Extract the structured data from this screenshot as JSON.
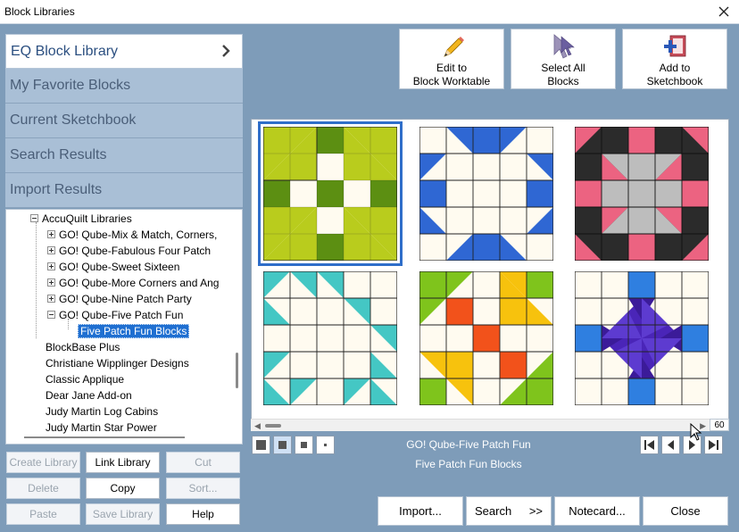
{
  "window": {
    "title": "Block Libraries"
  },
  "nav": {
    "items": [
      {
        "label": "EQ Block Library",
        "active": true
      },
      {
        "label": "My Favorite Blocks"
      },
      {
        "label": "Current Sketchbook"
      },
      {
        "label": "Search Results"
      },
      {
        "label": "Import Results"
      }
    ]
  },
  "tree": {
    "rows": [
      {
        "label": "AccuQuilt Libraries"
      },
      {
        "label": "GO! Qube-Mix & Match, Corners,"
      },
      {
        "label": "GO! Qube-Fabulous Four Patch"
      },
      {
        "label": "GO! Qube-Sweet Sixteen"
      },
      {
        "label": "GO! Qube-More Corners and Ang"
      },
      {
        "label": "GO! Qube-Nine Patch Party"
      },
      {
        "label": "GO! Qube-Five Patch Fun"
      },
      {
        "label": "Five Patch Fun Blocks"
      },
      {
        "label": "BlockBase Plus"
      },
      {
        "label": "Christiane Wipplinger Designs"
      },
      {
        "label": "Classic Applique"
      },
      {
        "label": "Dear Jane Add-on"
      },
      {
        "label": "Judy Martin Log Cabins"
      },
      {
        "label": "Judy Martin Star Power"
      }
    ]
  },
  "left_buttons": [
    {
      "label": "Create Library",
      "enabled": false
    },
    {
      "label": "Link Library",
      "enabled": true
    },
    {
      "label": "Cut",
      "enabled": false
    },
    {
      "label": "Delete",
      "enabled": false
    },
    {
      "label": "Copy",
      "enabled": true
    },
    {
      "label": "Sort...",
      "enabled": false
    },
    {
      "label": "Paste",
      "enabled": false
    },
    {
      "label": "Save Library",
      "enabled": false
    },
    {
      "label": "Help",
      "enabled": true
    }
  ],
  "tools": {
    "edit": {
      "line1": "Edit to",
      "line2": "Block Worktable"
    },
    "select_all": {
      "line1": "Select All",
      "line2": "Blocks"
    },
    "add": {
      "line1": "Add to",
      "line2": "Sketchbook"
    }
  },
  "grid": {
    "count": "60"
  },
  "caption": {
    "library": "GO! Qube-Five Patch Fun",
    "category": "Five Patch Fun Blocks"
  },
  "bottom_buttons": {
    "import": "Import...",
    "search": "Search",
    "search_arrows": ">>",
    "notecard": "Notecard...",
    "close": "Close"
  },
  "colors": {
    "background": "#7e9cb9",
    "nav_inactive": "#a9bfd6",
    "selection": "#1f6fd1",
    "block_lime": "#b9cc1d",
    "block_green": "#5c8f12",
    "block_blue": "#2f67d3",
    "block_pink": "#ec6381",
    "block_teal": "#44c7c4",
    "block_purple": "#4a25b8",
    "block_cream": "#fffbf0"
  }
}
